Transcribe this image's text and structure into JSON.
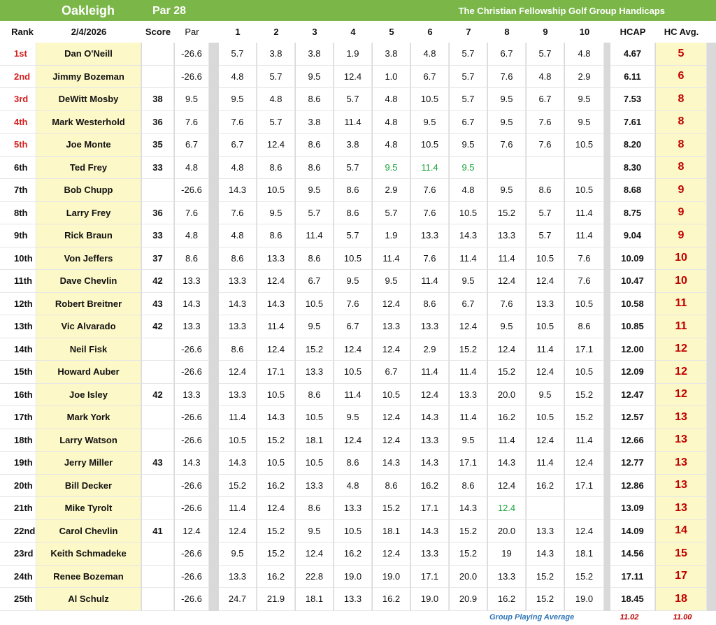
{
  "banner": {
    "course": "Oakleigh",
    "par": "Par 28",
    "org": "The Christian Fellowship Golf Group Handicaps"
  },
  "header": {
    "rank": "Rank",
    "date": "2/4/2026",
    "score": "Score",
    "par": "Par",
    "cols": [
      "1",
      "2",
      "3",
      "4",
      "5",
      "6",
      "7",
      "8",
      "9",
      "10"
    ],
    "hcap": "HCAP",
    "hcavg": "HC Avg."
  },
  "colors": {
    "banner": "#7ab648",
    "name_bg": "#fdf8c7",
    "top_rank": "#d32020",
    "hcavg": "#c00000",
    "green_value": "#1aa33a",
    "footer_label": "#2e75b6"
  },
  "rows": [
    {
      "rank": "1st",
      "name": "Dan O'Neill",
      "score": "",
      "par": "-26.6",
      "vals": [
        "5.7",
        "3.8",
        "3.8",
        "1.9",
        "3.8",
        "4.8",
        "5.7",
        "6.7",
        "5.7",
        "4.8"
      ],
      "hcap": "4.67",
      "hcavg": "5"
    },
    {
      "rank": "2nd",
      "name": "Jimmy Bozeman",
      "score": "",
      "par": "-26.6",
      "vals": [
        "4.8",
        "5.7",
        "9.5",
        "12.4",
        "1.0",
        "6.7",
        "5.7",
        "7.6",
        "4.8",
        "2.9"
      ],
      "hcap": "6.11",
      "hcavg": "6"
    },
    {
      "rank": "3rd",
      "name": "DeWitt Mosby",
      "score": "38",
      "par": "9.5",
      "vals": [
        "9.5",
        "4.8",
        "8.6",
        "5.7",
        "4.8",
        "10.5",
        "5.7",
        "9.5",
        "6.7",
        "9.5"
      ],
      "hcap": "7.53",
      "hcavg": "8"
    },
    {
      "rank": "4th",
      "name": "Mark Westerhold",
      "score": "36",
      "par": "7.6",
      "vals": [
        "7.6",
        "5.7",
        "3.8",
        "11.4",
        "4.8",
        "9.5",
        "6.7",
        "9.5",
        "7.6",
        "9.5"
      ],
      "hcap": "7.61",
      "hcavg": "8"
    },
    {
      "rank": "5th",
      "name": "Joe Monte",
      "score": "35",
      "par": "6.7",
      "vals": [
        "6.7",
        "12.4",
        "8.6",
        "3.8",
        "4.8",
        "10.5",
        "9.5",
        "7.6",
        "7.6",
        "10.5"
      ],
      "hcap": "8.20",
      "hcavg": "8"
    },
    {
      "rank": "6th",
      "name": "Ted Frey",
      "score": "33",
      "par": "4.8",
      "vals": [
        "4.8",
        "8.6",
        "8.6",
        "5.7",
        "9.5",
        "11.4",
        "9.5",
        "",
        "",
        ""
      ],
      "hcap": "8.30",
      "hcavg": "8",
      "green": [
        4,
        5,
        6
      ]
    },
    {
      "rank": "7th",
      "name": "Bob Chupp",
      "score": "",
      "par": "-26.6",
      "vals": [
        "14.3",
        "10.5",
        "9.5",
        "8.6",
        "2.9",
        "7.6",
        "4.8",
        "9.5",
        "8.6",
        "10.5"
      ],
      "hcap": "8.68",
      "hcavg": "9"
    },
    {
      "rank": "8th",
      "name": "Larry Frey",
      "score": "36",
      "par": "7.6",
      "vals": [
        "7.6",
        "9.5",
        "5.7",
        "8.6",
        "5.7",
        "7.6",
        "10.5",
        "15.2",
        "5.7",
        "11.4"
      ],
      "hcap": "8.75",
      "hcavg": "9"
    },
    {
      "rank": "9th",
      "name": "Rick Braun",
      "score": "33",
      "par": "4.8",
      "vals": [
        "4.8",
        "8.6",
        "11.4",
        "5.7",
        "1.9",
        "13.3",
        "14.3",
        "13.3",
        "5.7",
        "11.4"
      ],
      "hcap": "9.04",
      "hcavg": "9"
    },
    {
      "rank": "10th",
      "name": "Von Jeffers",
      "score": "37",
      "par": "8.6",
      "vals": [
        "8.6",
        "13.3",
        "8.6",
        "10.5",
        "11.4",
        "7.6",
        "11.4",
        "11.4",
        "10.5",
        "7.6"
      ],
      "hcap": "10.09",
      "hcavg": "10"
    },
    {
      "rank": "11th",
      "name": "Dave Chevlin",
      "score": "42",
      "par": "13.3",
      "vals": [
        "13.3",
        "12.4",
        "6.7",
        "9.5",
        "9.5",
        "11.4",
        "9.5",
        "12.4",
        "12.4",
        "7.6"
      ],
      "hcap": "10.47",
      "hcavg": "10"
    },
    {
      "rank": "12th",
      "name": "Robert Breitner",
      "score": "43",
      "par": "14.3",
      "vals": [
        "14.3",
        "14.3",
        "10.5",
        "7.6",
        "12.4",
        "8.6",
        "6.7",
        "7.6",
        "13.3",
        "10.5"
      ],
      "hcap": "10.58",
      "hcavg": "11"
    },
    {
      "rank": "13th",
      "name": "Vic Alvarado",
      "score": "42",
      "par": "13.3",
      "vals": [
        "13.3",
        "11.4",
        "9.5",
        "6.7",
        "13.3",
        "13.3",
        "12.4",
        "9.5",
        "10.5",
        "8.6"
      ],
      "hcap": "10.85",
      "hcavg": "11"
    },
    {
      "rank": "14th",
      "name": "Neil Fisk",
      "score": "",
      "par": "-26.6",
      "vals": [
        "8.6",
        "12.4",
        "15.2",
        "12.4",
        "12.4",
        "2.9",
        "15.2",
        "12.4",
        "11.4",
        "17.1"
      ],
      "hcap": "12.00",
      "hcavg": "12"
    },
    {
      "rank": "15th",
      "name": "Howard Auber",
      "score": "",
      "par": "-26.6",
      "vals": [
        "12.4",
        "17.1",
        "13.3",
        "10.5",
        "6.7",
        "11.4",
        "11.4",
        "15.2",
        "12.4",
        "10.5"
      ],
      "hcap": "12.09",
      "hcavg": "12"
    },
    {
      "rank": "16th",
      "name": "Joe Isley",
      "score": "42",
      "par": "13.3",
      "vals": [
        "13.3",
        "10.5",
        "8.6",
        "11.4",
        "10.5",
        "12.4",
        "13.3",
        "20.0",
        "9.5",
        "15.2"
      ],
      "hcap": "12.47",
      "hcavg": "12"
    },
    {
      "rank": "17th",
      "name": "Mark York",
      "score": "",
      "par": "-26.6",
      "vals": [
        "11.4",
        "14.3",
        "10.5",
        "9.5",
        "12.4",
        "14.3",
        "11.4",
        "16.2",
        "10.5",
        "15.2"
      ],
      "hcap": "12.57",
      "hcavg": "13"
    },
    {
      "rank": "18th",
      "name": "Larry Watson",
      "score": "",
      "par": "-26.6",
      "vals": [
        "10.5",
        "15.2",
        "18.1",
        "12.4",
        "12.4",
        "13.3",
        "9.5",
        "11.4",
        "12.4",
        "11.4"
      ],
      "hcap": "12.66",
      "hcavg": "13"
    },
    {
      "rank": "19th",
      "name": "Jerry Miller",
      "score": "43",
      "par": "14.3",
      "vals": [
        "14.3",
        "10.5",
        "10.5",
        "8.6",
        "14.3",
        "14.3",
        "17.1",
        "14.3",
        "11.4",
        "12.4"
      ],
      "hcap": "12.77",
      "hcavg": "13"
    },
    {
      "rank": "20th",
      "name": "Bill Decker",
      "score": "",
      "par": "-26.6",
      "vals": [
        "15.2",
        "16.2",
        "13.3",
        "4.8",
        "8.6",
        "16.2",
        "8.6",
        "12.4",
        "16.2",
        "17.1"
      ],
      "hcap": "12.86",
      "hcavg": "13"
    },
    {
      "rank": "21th",
      "name": "Mike Tyrolt",
      "score": "",
      "par": "-26.6",
      "vals": [
        "11.4",
        "12.4",
        "8.6",
        "13.3",
        "15.2",
        "17.1",
        "14.3",
        "12.4",
        "",
        ""
      ],
      "hcap": "13.09",
      "hcavg": "13",
      "green": [
        7
      ]
    },
    {
      "rank": "22nd",
      "name": "Carol Chevlin",
      "score": "41",
      "par": "12.4",
      "vals": [
        "12.4",
        "15.2",
        "9.5",
        "10.5",
        "18.1",
        "14.3",
        "15.2",
        "20.0",
        "13.3",
        "12.4"
      ],
      "hcap": "14.09",
      "hcavg": "14"
    },
    {
      "rank": "23rd",
      "name": "Keith Schmadeke",
      "score": "",
      "par": "-26.6",
      "vals": [
        "9.5",
        "15.2",
        "12.4",
        "16.2",
        "12.4",
        "13.3",
        "15.2",
        "19",
        "14.3",
        "18.1"
      ],
      "hcap": "14.56",
      "hcavg": "15"
    },
    {
      "rank": "24th",
      "name": "Renee Bozeman",
      "score": "",
      "par": "-26.6",
      "vals": [
        "13.3",
        "16.2",
        "22.8",
        "19.0",
        "19.0",
        "17.1",
        "20.0",
        "13.3",
        "15.2",
        "15.2"
      ],
      "hcap": "17.11",
      "hcavg": "17"
    },
    {
      "rank": "25th",
      "name": "Al Schulz",
      "score": "",
      "par": "-26.6",
      "vals": [
        "24.7",
        "21.9",
        "18.1",
        "13.3",
        "16.2",
        "19.0",
        "20.9",
        "16.2",
        "15.2",
        "19.0"
      ],
      "hcap": "18.45",
      "hcavg": "18"
    }
  ],
  "footer": {
    "label": "Group Playing Average",
    "hcap_avg": "11.02",
    "hcavg_avg": "11.00"
  }
}
